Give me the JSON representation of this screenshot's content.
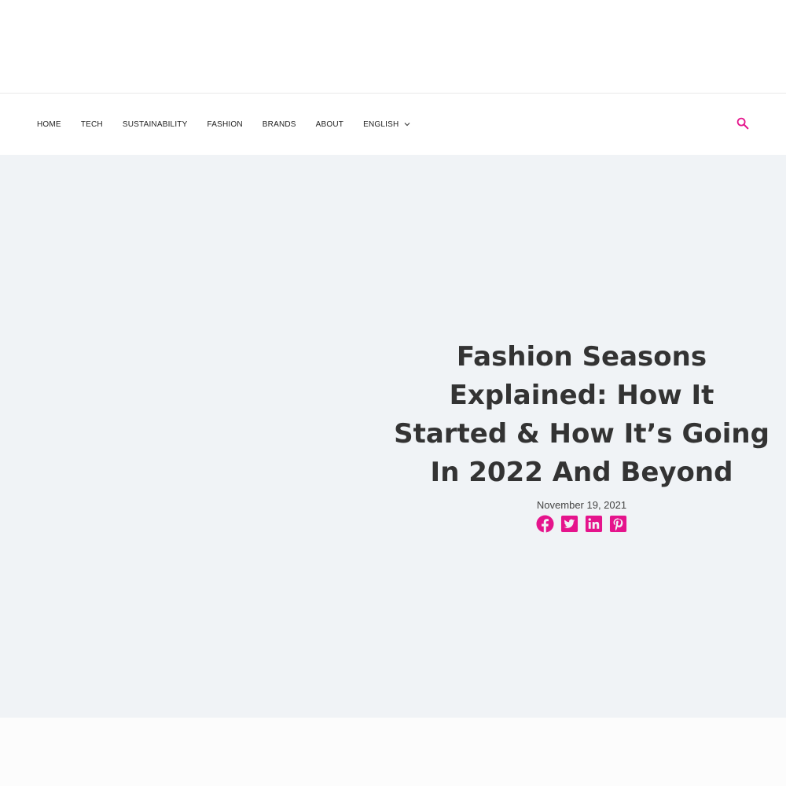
{
  "nav": {
    "items": [
      {
        "label": "HOME"
      },
      {
        "label": "TECH"
      },
      {
        "label": "SUSTAINABILITY"
      },
      {
        "label": "FASHION"
      },
      {
        "label": "BRANDS"
      },
      {
        "label": "ABOUT"
      },
      {
        "label": "ENGLISH",
        "has_dropdown": true
      }
    ],
    "search_icon": "search-icon"
  },
  "post": {
    "title": "Fashion Seasons Explained: How It Started & How It’s Going In 2022 And Beyond",
    "date": "November 19, 2021"
  },
  "share": {
    "icons": [
      "facebook-icon",
      "twitter-icon",
      "linkedin-icon",
      "pinterest-icon"
    ]
  },
  "colors": {
    "accent": "#e5148c",
    "hero_bg": "#f0f3f6",
    "title_text": "#333333"
  }
}
